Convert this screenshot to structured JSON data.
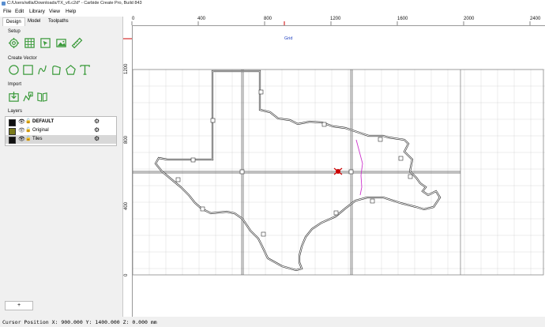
{
  "window": {
    "title": "C:/Users/willa/Downloads/TX_v6.c2d* - Carbide Create Pro, Build 843"
  },
  "menu": {
    "file": "File",
    "edit": "Edit",
    "library": "Library",
    "view": "View",
    "help": "Help"
  },
  "tabs": {
    "design": "Design",
    "model": "Model",
    "toolpaths": "Toolpaths"
  },
  "sections": {
    "setup": "Setup",
    "create_vector": "Create Vector",
    "import": "Import",
    "layers": "Layers"
  },
  "layers": [
    {
      "name": "DEFAULT",
      "color": "#111111",
      "bold": true
    },
    {
      "name": "Original",
      "color": "#7a7a1a",
      "bold": false
    },
    {
      "name": "Tiles",
      "color": "#111111",
      "bold": false
    }
  ],
  "add_layer_label": "+",
  "ruler": {
    "top_labels": [
      "0",
      "400",
      "800",
      "1200",
      "1600",
      "2000",
      "2400"
    ],
    "left_labels": [
      "1200",
      "800",
      "400",
      "0"
    ]
  },
  "canvas": {
    "grid_label": "Grid"
  },
  "status": {
    "cursor_position": "Cursor Position X: 900.000 Y: 1400.000 Z: 0.000 mm"
  },
  "colors": {
    "accent": "#3a9a3a",
    "marker": "#cc0000",
    "selection": "#cc33cc"
  }
}
